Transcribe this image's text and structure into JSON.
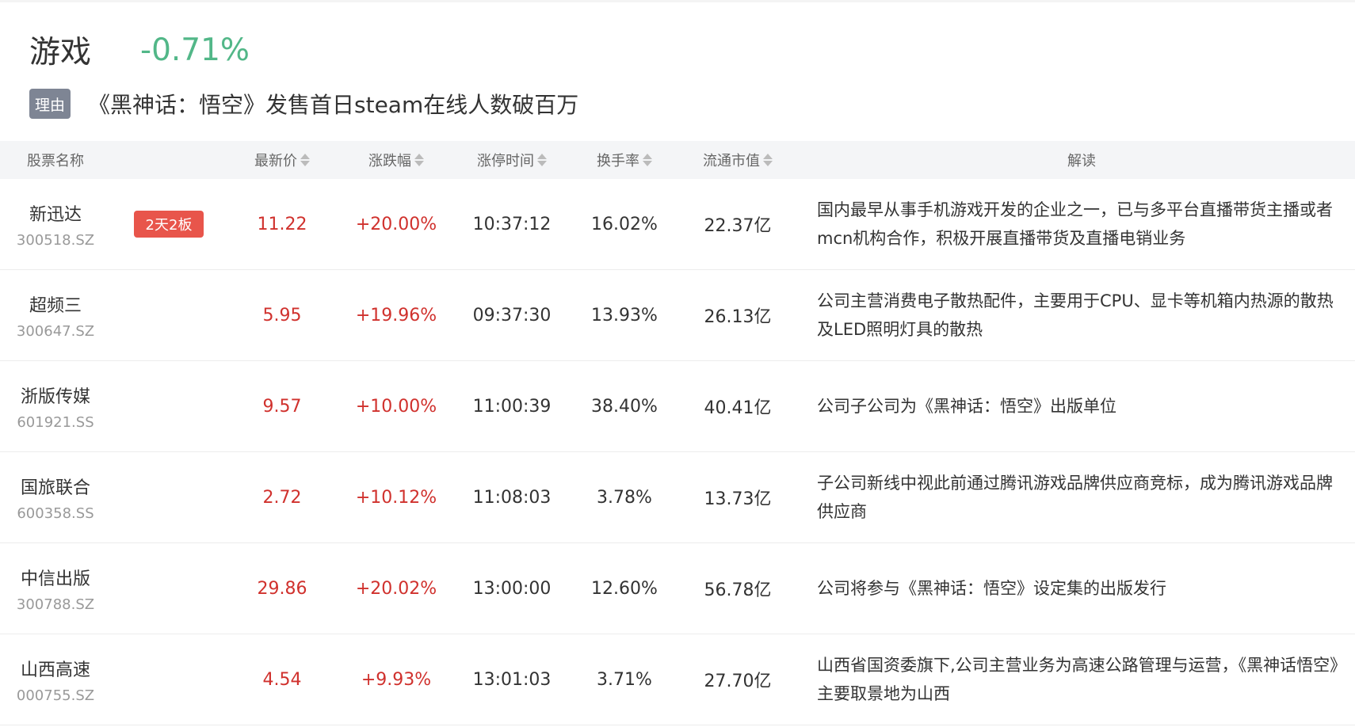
{
  "sector": {
    "name": "游戏",
    "change": "-0.71%",
    "change_color": "#52b788"
  },
  "reason": {
    "tag": "理由",
    "text": "《黑神话：悟空》发售首日steam在线人数破百万"
  },
  "table": {
    "headers": {
      "name": "股票名称",
      "price": "最新价",
      "change": "涨跌幅",
      "limit_time": "涨停时间",
      "turnover": "换手率",
      "market_cap": "流通市值",
      "interpretation": "解读"
    },
    "rows": [
      {
        "name": "新迅达",
        "code": "300518.SZ",
        "badge": "2天2板",
        "price": "11.22",
        "change": "+20.00%",
        "limit_time": "10:37:12",
        "turnover": "16.02%",
        "market_cap": "22.37亿",
        "interpretation": "国内最早从事手机游戏开发的企业之一，已与多平台直播带货主播或者mcn机构合作，积极开展直播带货及直播电销业务"
      },
      {
        "name": "超频三",
        "code": "300647.SZ",
        "badge": "",
        "price": "5.95",
        "change": "+19.96%",
        "limit_time": "09:37:30",
        "turnover": "13.93%",
        "market_cap": "26.13亿",
        "interpretation": "公司主营消费电子散热配件，主要用于CPU、显卡等机箱内热源的散热及LED照明灯具的散热"
      },
      {
        "name": "浙版传媒",
        "code": "601921.SS",
        "badge": "",
        "price": "9.57",
        "change": "+10.00%",
        "limit_time": "11:00:39",
        "turnover": "38.40%",
        "market_cap": "40.41亿",
        "interpretation": "公司子公司为《黑神话：悟空》出版单位"
      },
      {
        "name": "国旅联合",
        "code": "600358.SS",
        "badge": "",
        "price": "2.72",
        "change": "+10.12%",
        "limit_time": "11:08:03",
        "turnover": "3.78%",
        "market_cap": "13.73亿",
        "interpretation": "子公司新线中视此前通过腾讯游戏品牌供应商竞标，成为腾讯游戏品牌供应商"
      },
      {
        "name": "中信出版",
        "code": "300788.SZ",
        "badge": "",
        "price": "29.86",
        "change": "+20.02%",
        "limit_time": "13:00:00",
        "turnover": "12.60%",
        "market_cap": "56.78亿",
        "interpretation": "公司将参与《黑神话：悟空》设定集的出版发行"
      },
      {
        "name": "山西高速",
        "code": "000755.SZ",
        "badge": "",
        "price": "4.54",
        "change": "+9.93%",
        "limit_time": "13:01:03",
        "turnover": "3.71%",
        "market_cap": "27.70亿",
        "interpretation": "山西省国资委旗下,公司主营业务为高速公路管理与运营，《黑神话悟空》主要取景地为山西"
      }
    ]
  }
}
